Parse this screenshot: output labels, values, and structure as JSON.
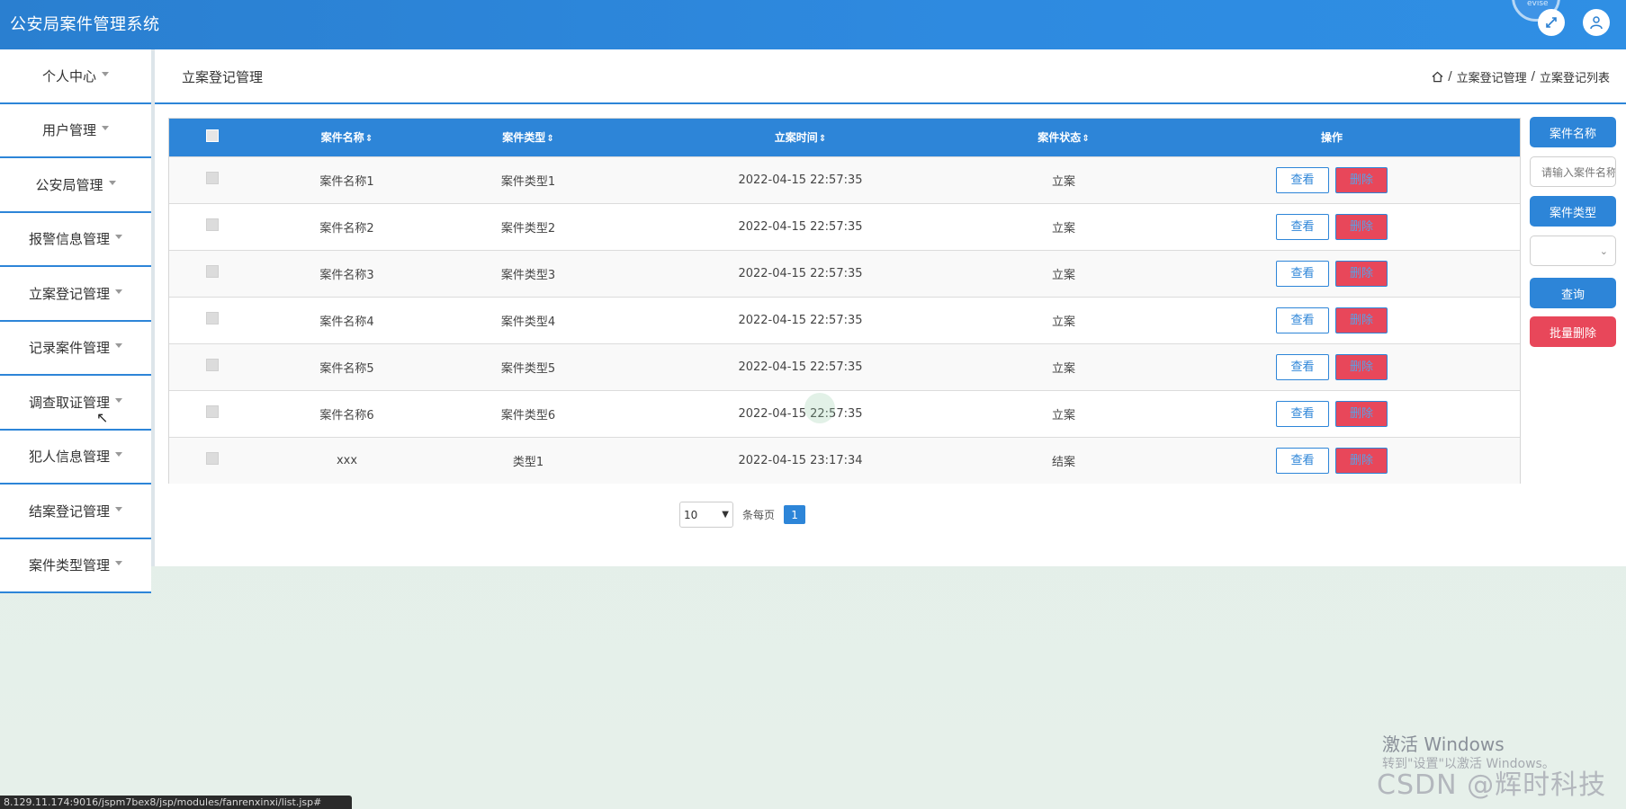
{
  "app": {
    "title": "公安局案件管理系统"
  },
  "header": {
    "ring_text": "evise"
  },
  "sidebar": {
    "items": [
      {
        "label": "个人中心"
      },
      {
        "label": "用户管理"
      },
      {
        "label": "公安局管理"
      },
      {
        "label": "报警信息管理"
      },
      {
        "label": "立案登记管理"
      },
      {
        "label": "记录案件管理"
      },
      {
        "label": "调查取证管理"
      },
      {
        "label": "犯人信息管理"
      },
      {
        "label": "结案登记管理"
      },
      {
        "label": "案件类型管理"
      }
    ]
  },
  "main": {
    "page_title": "立案登记管理",
    "breadcrumb": {
      "sep": "/",
      "level1": "立案登记管理",
      "level2": "立案登记列表"
    }
  },
  "table": {
    "headers": {
      "name": "案件名称",
      "type": "案件类型",
      "time": "立案时间",
      "status": "案件状态",
      "actions": "操作"
    },
    "sort_glyph": "⇕",
    "view_label": "查看",
    "delete_label": "删除",
    "rows": [
      {
        "name": "案件名称1",
        "type": "案件类型1",
        "time": "2022-04-15 22:57:35",
        "status": "立案"
      },
      {
        "name": "案件名称2",
        "type": "案件类型2",
        "time": "2022-04-15 22:57:35",
        "status": "立案"
      },
      {
        "name": "案件名称3",
        "type": "案件类型3",
        "time": "2022-04-15 22:57:35",
        "status": "立案"
      },
      {
        "name": "案件名称4",
        "type": "案件类型4",
        "time": "2022-04-15 22:57:35",
        "status": "立案"
      },
      {
        "name": "案件名称5",
        "type": "案件类型5",
        "time": "2022-04-15 22:57:35",
        "status": "立案"
      },
      {
        "name": "案件名称6",
        "type": "案件类型6",
        "time": "2022-04-15 22:57:35",
        "status": "立案"
      },
      {
        "name": "xxx",
        "type": "类型1",
        "time": "2022-04-15 23:17:34",
        "status": "结案"
      }
    ]
  },
  "pagination": {
    "page_size": "10",
    "per_page_label": "条每页",
    "current_page": "1"
  },
  "search": {
    "name_label": "案件名称",
    "name_placeholder": "请输入案件名称",
    "type_label": "案件类型",
    "type_value": "",
    "query_label": "查询",
    "batch_delete_label": "批量删除"
  },
  "statusbar": {
    "url": "8.129.11.174:9016/jspm7bex8/jsp/modules/fanrenxinxi/list.jsp#"
  },
  "watermark": {
    "windows_title": "激活 Windows",
    "windows_sub": "转到\"设置\"以激活 Windows。",
    "csdn": "CSDN @辉时科技"
  },
  "colors": {
    "primary": "#2d85d8",
    "danger": "#e8475a",
    "header_gradient_start": "#2a7fd0"
  },
  "icons": {
    "expand": "expand-icon",
    "user": "user-icon",
    "home": "home-icon",
    "cursor": "cursor-icon"
  }
}
